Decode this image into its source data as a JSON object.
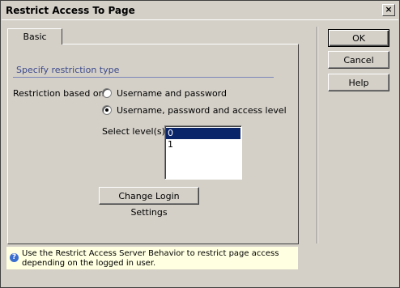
{
  "window": {
    "title": "Restrict Access To Page",
    "close_glyph": "×"
  },
  "tabs": [
    {
      "label": "Basic"
    }
  ],
  "section": {
    "label": "Specify restriction type"
  },
  "restriction": {
    "label": "Restriction based on:",
    "options": [
      {
        "label": "Username and password",
        "checked": false
      },
      {
        "label": "Username, password and access level",
        "checked": true
      }
    ]
  },
  "levels": {
    "label": "Select level(s):",
    "items": [
      "0",
      "1"
    ],
    "selected": "0"
  },
  "buttons": {
    "change_login": "Change Login Settings",
    "ok": "OK",
    "cancel": "Cancel",
    "help": "Help"
  },
  "hint": {
    "icon": "?",
    "text": "Use the Restrict Access Server Behavior to restrict page access depending on the logged in user."
  }
}
